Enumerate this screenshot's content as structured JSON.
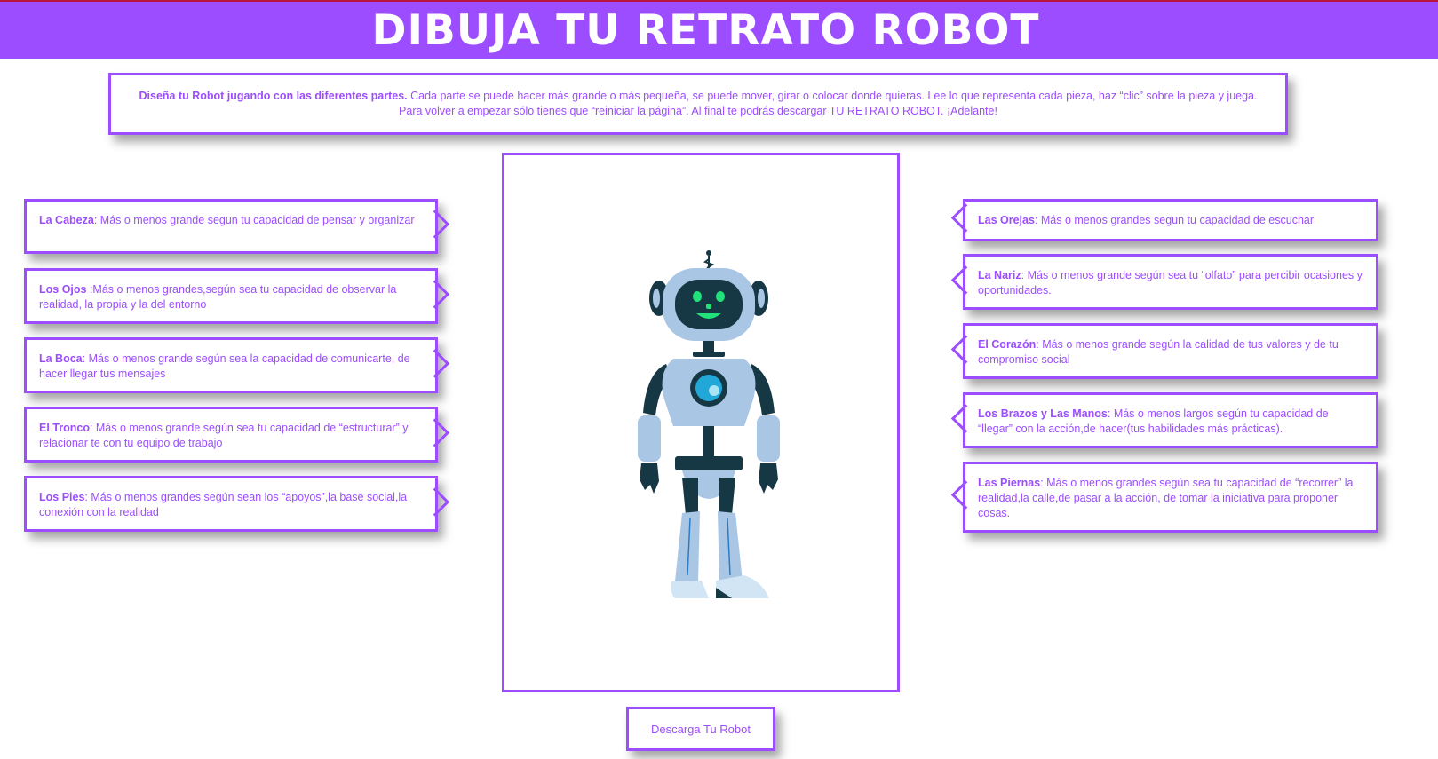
{
  "header": {
    "title": "DIBUJA TU RETRATO ROBOT"
  },
  "intro": {
    "bold": "Diseña tu Robot jugando con las diferentes partes.",
    "text": " Cada parte se puede hacer más grande o más pequeña, se puede mover, girar o colocar donde quieras. Lee lo que representa cada pieza, haz “clic” sobre la pieza y juega. Para volver a empezar sólo tienes que “reiniciar la página”. Al final te podrás descargar TU RETRATO ROBOT. ¡Adelante!"
  },
  "left_cards": [
    {
      "name": "La Cabeza",
      "desc": ": Más o menos grande segun tu capacidad de pensar y organizar"
    },
    {
      "name": "Los Ojos",
      "desc": " :Más o menos grandes,según sea tu capacidad de observar la realidad, la propia y la del entorno"
    },
    {
      "name": "La Boca",
      "desc": ": Más o menos grande según sea la capacidad de comunicarte, de hacer llegar tus mensajes"
    },
    {
      "name": "El Tronco",
      "desc": ": Más o menos grande según sea tu capacidad de “estructurar” y relacionar te con tu equipo de trabajo"
    },
    {
      "name": "Los Pies",
      "desc": ": Más o menos grandes según sean los “apoyos”,la base social,la conexión con la realidad"
    }
  ],
  "right_cards": [
    {
      "name": "Las Orejas",
      "desc": ": Más o menos grandes segun tu capacidad de escuchar"
    },
    {
      "name": "La Nariz",
      "desc": ": Más o menos grande según sea tu “olfato” para percibir ocasiones y oportunidades."
    },
    {
      "name": "El Corazón",
      "desc": ": Más o menos grande según la calidad de tus valores y de tu compromiso social"
    },
    {
      "name": "Los Brazos y Las Manos",
      "desc": ": Más o menos largos según tu capacidad de “llegar” con la acción,de hacer(tus habilidades más prácticas)."
    },
    {
      "name": "Las Piernas",
      "desc": ": Más o menos grandes según sea tu capacidad de “recorrer” la realidad,la calle,de pasar a la acción, de tomar la iniciativa para proponer cosas."
    }
  ],
  "download": {
    "label": "Descarga Tu Robot"
  },
  "colors": {
    "accent": "#9c4dff",
    "robot_dark": "#163845",
    "robot_light": "#a9c6e4",
    "robot_eyes": "#22e07a"
  }
}
